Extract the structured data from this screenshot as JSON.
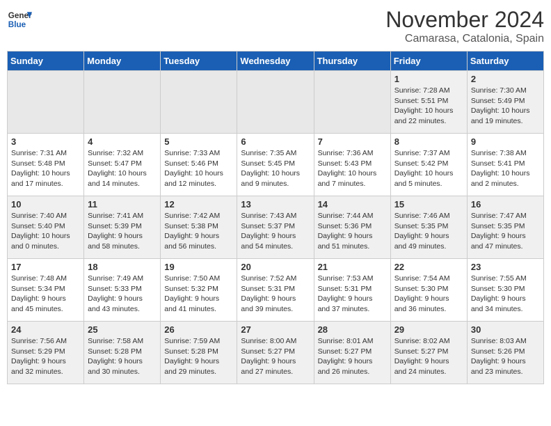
{
  "header": {
    "logo_line1": "General",
    "logo_line2": "Blue",
    "month": "November 2024",
    "location": "Camarasa, Catalonia, Spain"
  },
  "weekdays": [
    "Sunday",
    "Monday",
    "Tuesday",
    "Wednesday",
    "Thursday",
    "Friday",
    "Saturday"
  ],
  "weeks": [
    [
      {
        "day": "",
        "info": ""
      },
      {
        "day": "",
        "info": ""
      },
      {
        "day": "",
        "info": ""
      },
      {
        "day": "",
        "info": ""
      },
      {
        "day": "",
        "info": ""
      },
      {
        "day": "1",
        "info": "Sunrise: 7:28 AM\nSunset: 5:51 PM\nDaylight: 10 hours and 22 minutes."
      },
      {
        "day": "2",
        "info": "Sunrise: 7:30 AM\nSunset: 5:49 PM\nDaylight: 10 hours and 19 minutes."
      }
    ],
    [
      {
        "day": "3",
        "info": "Sunrise: 7:31 AM\nSunset: 5:48 PM\nDaylight: 10 hours and 17 minutes."
      },
      {
        "day": "4",
        "info": "Sunrise: 7:32 AM\nSunset: 5:47 PM\nDaylight: 10 hours and 14 minutes."
      },
      {
        "day": "5",
        "info": "Sunrise: 7:33 AM\nSunset: 5:46 PM\nDaylight: 10 hours and 12 minutes."
      },
      {
        "day": "6",
        "info": "Sunrise: 7:35 AM\nSunset: 5:45 PM\nDaylight: 10 hours and 9 minutes."
      },
      {
        "day": "7",
        "info": "Sunrise: 7:36 AM\nSunset: 5:43 PM\nDaylight: 10 hours and 7 minutes."
      },
      {
        "day": "8",
        "info": "Sunrise: 7:37 AM\nSunset: 5:42 PM\nDaylight: 10 hours and 5 minutes."
      },
      {
        "day": "9",
        "info": "Sunrise: 7:38 AM\nSunset: 5:41 PM\nDaylight: 10 hours and 2 minutes."
      }
    ],
    [
      {
        "day": "10",
        "info": "Sunrise: 7:40 AM\nSunset: 5:40 PM\nDaylight: 10 hours and 0 minutes."
      },
      {
        "day": "11",
        "info": "Sunrise: 7:41 AM\nSunset: 5:39 PM\nDaylight: 9 hours and 58 minutes."
      },
      {
        "day": "12",
        "info": "Sunrise: 7:42 AM\nSunset: 5:38 PM\nDaylight: 9 hours and 56 minutes."
      },
      {
        "day": "13",
        "info": "Sunrise: 7:43 AM\nSunset: 5:37 PM\nDaylight: 9 hours and 54 minutes."
      },
      {
        "day": "14",
        "info": "Sunrise: 7:44 AM\nSunset: 5:36 PM\nDaylight: 9 hours and 51 minutes."
      },
      {
        "day": "15",
        "info": "Sunrise: 7:46 AM\nSunset: 5:35 PM\nDaylight: 9 hours and 49 minutes."
      },
      {
        "day": "16",
        "info": "Sunrise: 7:47 AM\nSunset: 5:35 PM\nDaylight: 9 hours and 47 minutes."
      }
    ],
    [
      {
        "day": "17",
        "info": "Sunrise: 7:48 AM\nSunset: 5:34 PM\nDaylight: 9 hours and 45 minutes."
      },
      {
        "day": "18",
        "info": "Sunrise: 7:49 AM\nSunset: 5:33 PM\nDaylight: 9 hours and 43 minutes."
      },
      {
        "day": "19",
        "info": "Sunrise: 7:50 AM\nSunset: 5:32 PM\nDaylight: 9 hours and 41 minutes."
      },
      {
        "day": "20",
        "info": "Sunrise: 7:52 AM\nSunset: 5:31 PM\nDaylight: 9 hours and 39 minutes."
      },
      {
        "day": "21",
        "info": "Sunrise: 7:53 AM\nSunset: 5:31 PM\nDaylight: 9 hours and 37 minutes."
      },
      {
        "day": "22",
        "info": "Sunrise: 7:54 AM\nSunset: 5:30 PM\nDaylight: 9 hours and 36 minutes."
      },
      {
        "day": "23",
        "info": "Sunrise: 7:55 AM\nSunset: 5:30 PM\nDaylight: 9 hours and 34 minutes."
      }
    ],
    [
      {
        "day": "24",
        "info": "Sunrise: 7:56 AM\nSunset: 5:29 PM\nDaylight: 9 hours and 32 minutes."
      },
      {
        "day": "25",
        "info": "Sunrise: 7:58 AM\nSunset: 5:28 PM\nDaylight: 9 hours and 30 minutes."
      },
      {
        "day": "26",
        "info": "Sunrise: 7:59 AM\nSunset: 5:28 PM\nDaylight: 9 hours and 29 minutes."
      },
      {
        "day": "27",
        "info": "Sunrise: 8:00 AM\nSunset: 5:27 PM\nDaylight: 9 hours and 27 minutes."
      },
      {
        "day": "28",
        "info": "Sunrise: 8:01 AM\nSunset: 5:27 PM\nDaylight: 9 hours and 26 minutes."
      },
      {
        "day": "29",
        "info": "Sunrise: 8:02 AM\nSunset: 5:27 PM\nDaylight: 9 hours and 24 minutes."
      },
      {
        "day": "30",
        "info": "Sunrise: 8:03 AM\nSunset: 5:26 PM\nDaylight: 9 hours and 23 minutes."
      }
    ]
  ]
}
